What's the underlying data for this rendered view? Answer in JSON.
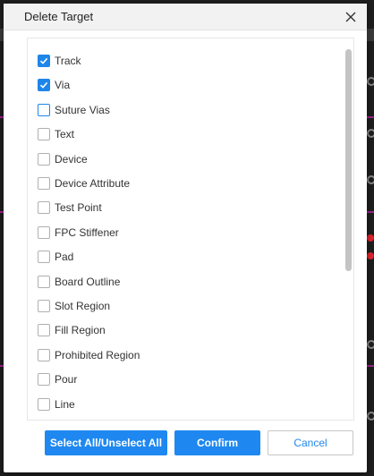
{
  "dialog": {
    "title": "Delete Target",
    "close_icon": "close-icon"
  },
  "items": [
    {
      "label": "Track",
      "checked": true
    },
    {
      "label": "Via",
      "checked": true
    },
    {
      "label": "Suture Vias",
      "checked": false,
      "focused": true
    },
    {
      "label": "Text",
      "checked": false
    },
    {
      "label": "Device",
      "checked": false
    },
    {
      "label": "Device Attribute",
      "checked": false
    },
    {
      "label": "Test Point",
      "checked": false
    },
    {
      "label": "FPC Stiffener",
      "checked": false
    },
    {
      "label": "Pad",
      "checked": false
    },
    {
      "label": "Board Outline",
      "checked": false
    },
    {
      "label": "Slot Region",
      "checked": false
    },
    {
      "label": "Fill Region",
      "checked": false
    },
    {
      "label": "Prohibited Region",
      "checked": false
    },
    {
      "label": "Pour",
      "checked": false
    },
    {
      "label": "Line",
      "checked": false
    }
  ],
  "buttons": {
    "select_all": "Select All/Unselect All",
    "confirm": "Confirm",
    "cancel": "Cancel"
  },
  "colors": {
    "accent": "#1e88f0",
    "checked": "#1e86e8"
  }
}
